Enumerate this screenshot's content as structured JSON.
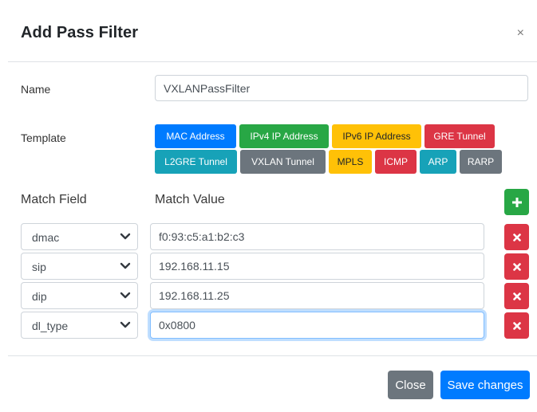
{
  "modal": {
    "title": "Add Pass Filter",
    "close_glyph": "×"
  },
  "name": {
    "label": "Name",
    "value": "VXLANPassFilter"
  },
  "template": {
    "label": "Template",
    "buttons": [
      {
        "label": "MAC Address",
        "color": "#007bff"
      },
      {
        "label": "IPv4 IP Address",
        "color": "#28a745"
      },
      {
        "label": "IPv6 IP Address",
        "color": "#ffc107"
      },
      {
        "label": "GRE Tunnel",
        "color": "#dc3545"
      },
      {
        "label": "L2GRE Tunnel",
        "color": "#17a2b8"
      },
      {
        "label": "VXLAN Tunnel",
        "color": "#6c757d"
      },
      {
        "label": "MPLS",
        "color": "#ffc107"
      },
      {
        "label": "ICMP",
        "color": "#dc3545"
      },
      {
        "label": "ARP",
        "color": "#17a2b8"
      },
      {
        "label": "RARP",
        "color": "#6c757d"
      }
    ]
  },
  "match": {
    "field_header": "Match Field",
    "value_header": "Match Value",
    "add_icon": "plus-icon",
    "remove_icon": "times-icon",
    "rows": [
      {
        "field": "dmac",
        "value": "f0:93:c5:a1:b2:c3"
      },
      {
        "field": "sip",
        "value": "192.168.11.15"
      },
      {
        "field": "dip",
        "value": "192.168.11.25"
      },
      {
        "field": "dl_type",
        "value": "0x0800"
      }
    ]
  },
  "footer": {
    "close_label": "Close",
    "save_label": "Save changes"
  },
  "colors": {
    "primary": "#007bff",
    "secondary": "#6c757d",
    "success": "#28a745",
    "danger": "#dc3545"
  }
}
